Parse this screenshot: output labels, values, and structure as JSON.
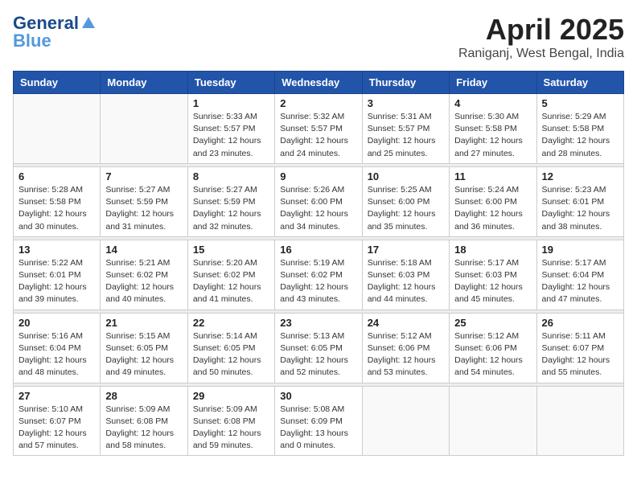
{
  "header": {
    "logo_general": "General",
    "logo_blue": "Blue",
    "month": "April 2025",
    "location": "Raniganj, West Bengal, India"
  },
  "weekdays": [
    "Sunday",
    "Monday",
    "Tuesday",
    "Wednesday",
    "Thursday",
    "Friday",
    "Saturday"
  ],
  "weeks": [
    [
      {
        "day": "",
        "info": ""
      },
      {
        "day": "",
        "info": ""
      },
      {
        "day": "1",
        "info": "Sunrise: 5:33 AM\nSunset: 5:57 PM\nDaylight: 12 hours\nand 23 minutes."
      },
      {
        "day": "2",
        "info": "Sunrise: 5:32 AM\nSunset: 5:57 PM\nDaylight: 12 hours\nand 24 minutes."
      },
      {
        "day": "3",
        "info": "Sunrise: 5:31 AM\nSunset: 5:57 PM\nDaylight: 12 hours\nand 25 minutes."
      },
      {
        "day": "4",
        "info": "Sunrise: 5:30 AM\nSunset: 5:58 PM\nDaylight: 12 hours\nand 27 minutes."
      },
      {
        "day": "5",
        "info": "Sunrise: 5:29 AM\nSunset: 5:58 PM\nDaylight: 12 hours\nand 28 minutes."
      }
    ],
    [
      {
        "day": "6",
        "info": "Sunrise: 5:28 AM\nSunset: 5:58 PM\nDaylight: 12 hours\nand 30 minutes."
      },
      {
        "day": "7",
        "info": "Sunrise: 5:27 AM\nSunset: 5:59 PM\nDaylight: 12 hours\nand 31 minutes."
      },
      {
        "day": "8",
        "info": "Sunrise: 5:27 AM\nSunset: 5:59 PM\nDaylight: 12 hours\nand 32 minutes."
      },
      {
        "day": "9",
        "info": "Sunrise: 5:26 AM\nSunset: 6:00 PM\nDaylight: 12 hours\nand 34 minutes."
      },
      {
        "day": "10",
        "info": "Sunrise: 5:25 AM\nSunset: 6:00 PM\nDaylight: 12 hours\nand 35 minutes."
      },
      {
        "day": "11",
        "info": "Sunrise: 5:24 AM\nSunset: 6:00 PM\nDaylight: 12 hours\nand 36 minutes."
      },
      {
        "day": "12",
        "info": "Sunrise: 5:23 AM\nSunset: 6:01 PM\nDaylight: 12 hours\nand 38 minutes."
      }
    ],
    [
      {
        "day": "13",
        "info": "Sunrise: 5:22 AM\nSunset: 6:01 PM\nDaylight: 12 hours\nand 39 minutes."
      },
      {
        "day": "14",
        "info": "Sunrise: 5:21 AM\nSunset: 6:02 PM\nDaylight: 12 hours\nand 40 minutes."
      },
      {
        "day": "15",
        "info": "Sunrise: 5:20 AM\nSunset: 6:02 PM\nDaylight: 12 hours\nand 41 minutes."
      },
      {
        "day": "16",
        "info": "Sunrise: 5:19 AM\nSunset: 6:02 PM\nDaylight: 12 hours\nand 43 minutes."
      },
      {
        "day": "17",
        "info": "Sunrise: 5:18 AM\nSunset: 6:03 PM\nDaylight: 12 hours\nand 44 minutes."
      },
      {
        "day": "18",
        "info": "Sunrise: 5:17 AM\nSunset: 6:03 PM\nDaylight: 12 hours\nand 45 minutes."
      },
      {
        "day": "19",
        "info": "Sunrise: 5:17 AM\nSunset: 6:04 PM\nDaylight: 12 hours\nand 47 minutes."
      }
    ],
    [
      {
        "day": "20",
        "info": "Sunrise: 5:16 AM\nSunset: 6:04 PM\nDaylight: 12 hours\nand 48 minutes."
      },
      {
        "day": "21",
        "info": "Sunrise: 5:15 AM\nSunset: 6:05 PM\nDaylight: 12 hours\nand 49 minutes."
      },
      {
        "day": "22",
        "info": "Sunrise: 5:14 AM\nSunset: 6:05 PM\nDaylight: 12 hours\nand 50 minutes."
      },
      {
        "day": "23",
        "info": "Sunrise: 5:13 AM\nSunset: 6:05 PM\nDaylight: 12 hours\nand 52 minutes."
      },
      {
        "day": "24",
        "info": "Sunrise: 5:12 AM\nSunset: 6:06 PM\nDaylight: 12 hours\nand 53 minutes."
      },
      {
        "day": "25",
        "info": "Sunrise: 5:12 AM\nSunset: 6:06 PM\nDaylight: 12 hours\nand 54 minutes."
      },
      {
        "day": "26",
        "info": "Sunrise: 5:11 AM\nSunset: 6:07 PM\nDaylight: 12 hours\nand 55 minutes."
      }
    ],
    [
      {
        "day": "27",
        "info": "Sunrise: 5:10 AM\nSunset: 6:07 PM\nDaylight: 12 hours\nand 57 minutes."
      },
      {
        "day": "28",
        "info": "Sunrise: 5:09 AM\nSunset: 6:08 PM\nDaylight: 12 hours\nand 58 minutes."
      },
      {
        "day": "29",
        "info": "Sunrise: 5:09 AM\nSunset: 6:08 PM\nDaylight: 12 hours\nand 59 minutes."
      },
      {
        "day": "30",
        "info": "Sunrise: 5:08 AM\nSunset: 6:09 PM\nDaylight: 13 hours\nand 0 minutes."
      },
      {
        "day": "",
        "info": ""
      },
      {
        "day": "",
        "info": ""
      },
      {
        "day": "",
        "info": ""
      }
    ]
  ]
}
